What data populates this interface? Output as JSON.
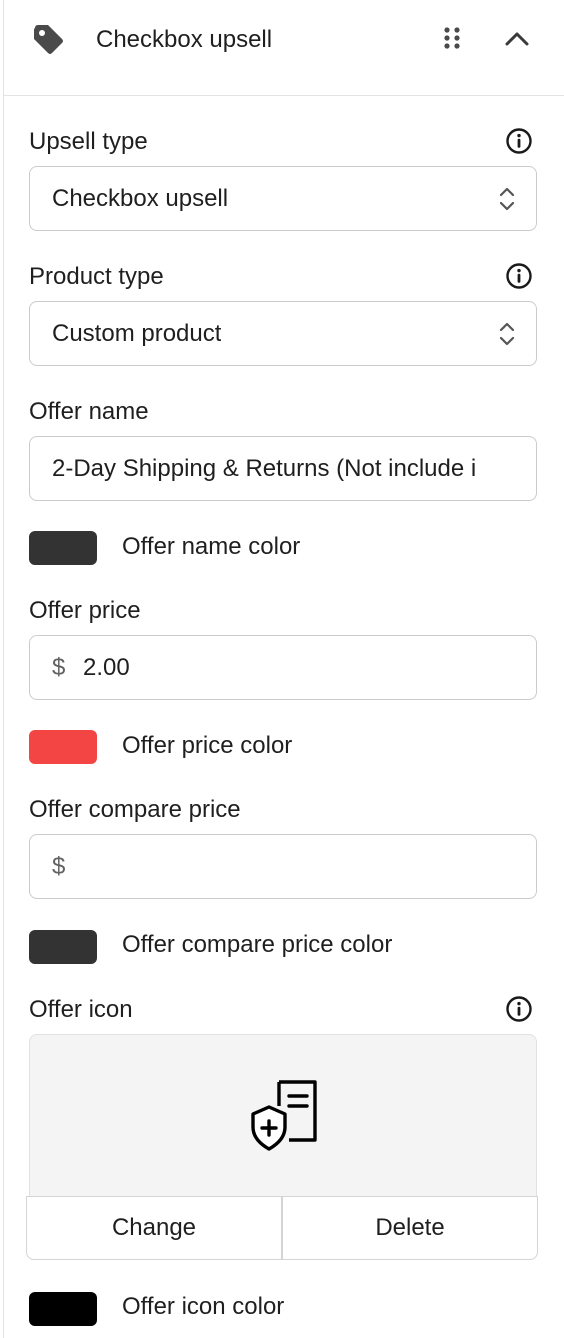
{
  "header": {
    "title": "Checkbox upsell",
    "icons": [
      "tag-icon",
      "drag-handle-icon",
      "chevron-up-icon"
    ]
  },
  "upsell_type": {
    "label": "Upsell type",
    "value": "Checkbox upsell"
  },
  "product_type": {
    "label": "Product type",
    "value": "Custom product"
  },
  "offer_name": {
    "label": "Offer name",
    "value": "2-Day Shipping & Returns (Not include i",
    "color_label": "Offer name color",
    "color": "#333333"
  },
  "offer_price": {
    "label": "Offer price",
    "currency": "$",
    "value": "2.00",
    "color_label": "Offer price color",
    "color": "#f44545"
  },
  "offer_compare_price": {
    "label": "Offer compare price",
    "currency": "$",
    "value": "",
    "color_label": "Offer compare price color",
    "color": "#333333"
  },
  "offer_icon": {
    "label": "Offer icon",
    "icon": "shield-document-icon",
    "change_label": "Change",
    "delete_label": "Delete",
    "color_label": "Offer icon color",
    "color": "#000000"
  }
}
